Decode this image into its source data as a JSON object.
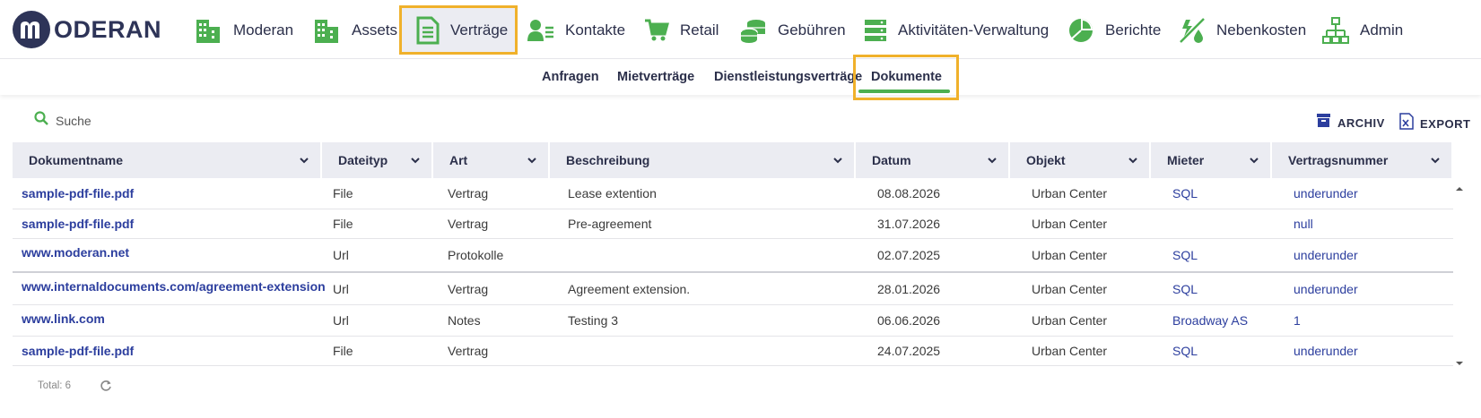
{
  "brand": {
    "name": "ODERAN",
    "accent": "#4caf50",
    "highlight": "#f0b12b",
    "dark": "#2e3458"
  },
  "nav": [
    {
      "label": "Moderan",
      "icon": "building-icon"
    },
    {
      "label": "Assets",
      "icon": "building-icon"
    },
    {
      "label": "Verträge",
      "icon": "document-icon",
      "active": true
    },
    {
      "label": "Kontakte",
      "icon": "contact-card-icon"
    },
    {
      "label": "Retail",
      "icon": "cart-icon"
    },
    {
      "label": "Gebühren",
      "icon": "coins-icon"
    },
    {
      "label": "Aktivitäten-Verwaltung",
      "icon": "server-list-icon"
    },
    {
      "label": "Berichte",
      "icon": "pie-chart-icon"
    },
    {
      "label": "Nebenkosten",
      "icon": "utility-icon"
    },
    {
      "label": "Admin",
      "icon": "org-chart-icon"
    }
  ],
  "subnav": [
    {
      "label": "Anfragen"
    },
    {
      "label": "Mietverträge"
    },
    {
      "label": "Dienstleistungsverträge"
    },
    {
      "label": "Dokumente",
      "active": true
    }
  ],
  "toolbar": {
    "search_label": "Suche",
    "archive_label": "ARCHIV",
    "export_label": "EXPORT"
  },
  "columns": [
    "Dokumentname",
    "Dateityp",
    "Art",
    "Beschreibung",
    "Datum",
    "Objekt",
    "Mieter",
    "Vertragsnummer"
  ],
  "rows": [
    {
      "name": "sample-pdf-file.pdf",
      "type": "File",
      "art": "Vertrag",
      "desc": "Lease extention",
      "date": "08.08.2026",
      "object": "Urban Center",
      "tenant": "SQL",
      "contract": "underunder"
    },
    {
      "name": "sample-pdf-file.pdf",
      "type": "File",
      "art": "Vertrag",
      "desc": "Pre-agreement",
      "date": "31.07.2026",
      "object": "Urban Center",
      "tenant": "",
      "contract": "null"
    },
    {
      "name": "www.moderan.net",
      "type": "Url",
      "art": "Protokolle",
      "desc": "",
      "date": "02.07.2025",
      "object": "Urban Center",
      "tenant": "SQL",
      "contract": "underunder"
    },
    {
      "name": "www.internaldocuments.com/agreement-extension",
      "type": "Url",
      "art": "Vertrag",
      "desc": "Agreement extension.",
      "date": "28.01.2026",
      "object": "Urban Center",
      "tenant": "SQL",
      "contract": "underunder"
    },
    {
      "name": "www.link.com",
      "type": "Url",
      "art": "Notes",
      "desc": "Testing 3",
      "date": "06.06.2026",
      "object": "Urban Center",
      "tenant": "Broadway AS",
      "contract": "1"
    },
    {
      "name": "sample-pdf-file.pdf",
      "type": "File",
      "art": "Vertrag",
      "desc": "",
      "date": "24.07.2025",
      "object": "Urban Center",
      "tenant": "SQL",
      "contract": "underunder"
    }
  ],
  "footer": {
    "total": "Total: 6"
  }
}
